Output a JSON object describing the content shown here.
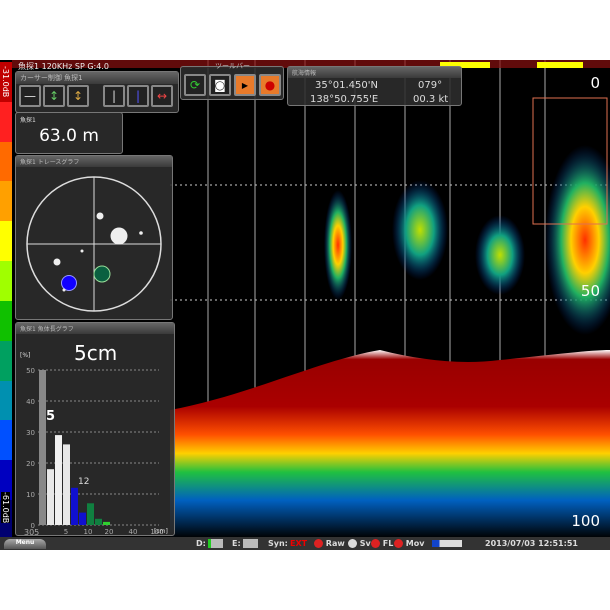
{
  "header": {
    "sounder_info": "魚探1  120KHz SP   G:4.0"
  },
  "colorbar": {
    "top_label": "-31.0dB",
    "bottom_label": "-61.0dB",
    "colors": [
      "#c00000",
      "#ff2020",
      "#ff6a00",
      "#ffa000",
      "#ffff00",
      "#a0ff00",
      "#10c000",
      "#00a060",
      "#0090b0",
      "#0050ff",
      "#0000c0",
      "#000070"
    ]
  },
  "cursor_panel": {
    "title": "カーサー制御  魚探1",
    "buttons": [
      "horizontal-line",
      "move-green",
      "move-orange",
      "vertical-line",
      "vertical-blue",
      "horizontal-red"
    ]
  },
  "depth_panel": {
    "title": "魚探1",
    "value": "63.0  m"
  },
  "toolbar": {
    "title": "ツールバー",
    "buttons": [
      "refresh",
      "camera",
      "record-video",
      "record"
    ]
  },
  "nav_panel": {
    "title": "航海情報",
    "lat": "35°01.450'N",
    "lon": "138°50.755'E",
    "heading": "079°",
    "speed": "00.3 kt"
  },
  "trace_panel": {
    "title": "魚探1 トレースグラフ"
  },
  "length_panel": {
    "title": "魚探1 魚体長グラフ",
    "size": "5cm",
    "count": "305",
    "ylabel": "[%]",
    "xlabel": "[cm]",
    "peak1": "5",
    "peak2": "12"
  },
  "chart_data": {
    "type": "bar",
    "ylim": [
      0,
      50
    ],
    "yticks": [
      "0",
      "10",
      "20",
      "30",
      "40",
      "50"
    ],
    "xticks": [
      "5",
      "10",
      "20",
      "40",
      "100"
    ],
    "values": [
      50,
      18,
      29,
      26,
      12,
      4,
      7,
      2,
      1
    ],
    "colors": [
      "#888888",
      "#e8e8e8",
      "#f0f0f0",
      "#e8e8e8",
      "#1010d0",
      "#1010d0",
      "#108040",
      "#108040",
      "#30d030"
    ]
  },
  "depth_scale": [
    "0",
    "50",
    "100"
  ],
  "status": {
    "d_label": "D:",
    "e_label": "E:",
    "syn_label": "Syn:",
    "syn_value": "EXT",
    "raw": "Raw",
    "sv": "Sv",
    "fl": "FL",
    "mov": "Mov",
    "datetime": "2013/07/03  12:51:51",
    "menu": "Menu"
  }
}
